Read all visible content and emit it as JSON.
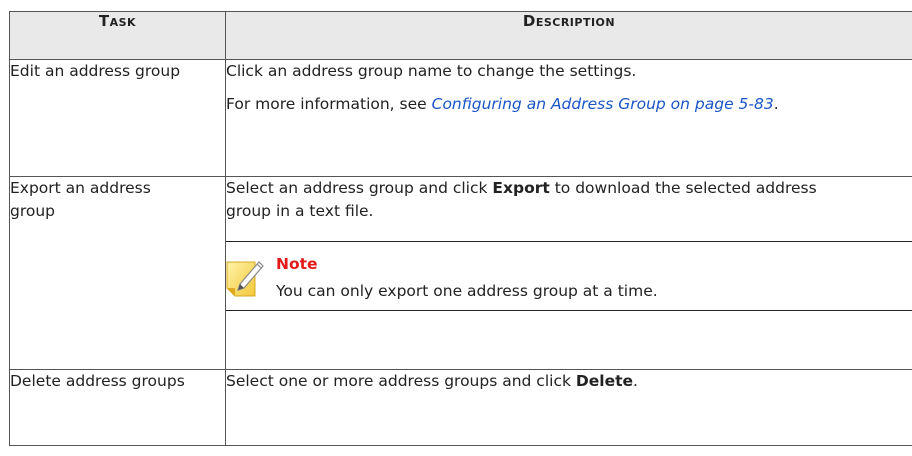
{
  "table": {
    "headers": {
      "task": "Task",
      "description": "Description"
    },
    "rows": [
      {
        "task": "Edit an address group",
        "desc_line1": "Click an address group name to change the settings.",
        "desc_more_prefix": "For more information, see ",
        "desc_link": "Configuring an Address Group on page 5-83",
        "desc_more_suffix": "."
      },
      {
        "task": "Export an address group",
        "desc_prefix": "Select an address group and click ",
        "desc_bold": "Export",
        "desc_suffix": " to download the selected address group in a text file.",
        "note_title": "Note",
        "note_text": "You can only export one address group at a time."
      },
      {
        "task": "Delete address groups",
        "desc_prefix": "Select one or more address groups and click ",
        "desc_bold": "Delete",
        "desc_suffix": "."
      }
    ]
  },
  "icons": {
    "note": "note-pencil-icon"
  },
  "colors": {
    "link": "#1a55c8",
    "note_title": "#e31a1a",
    "header_bg": "#e9e9e9"
  }
}
